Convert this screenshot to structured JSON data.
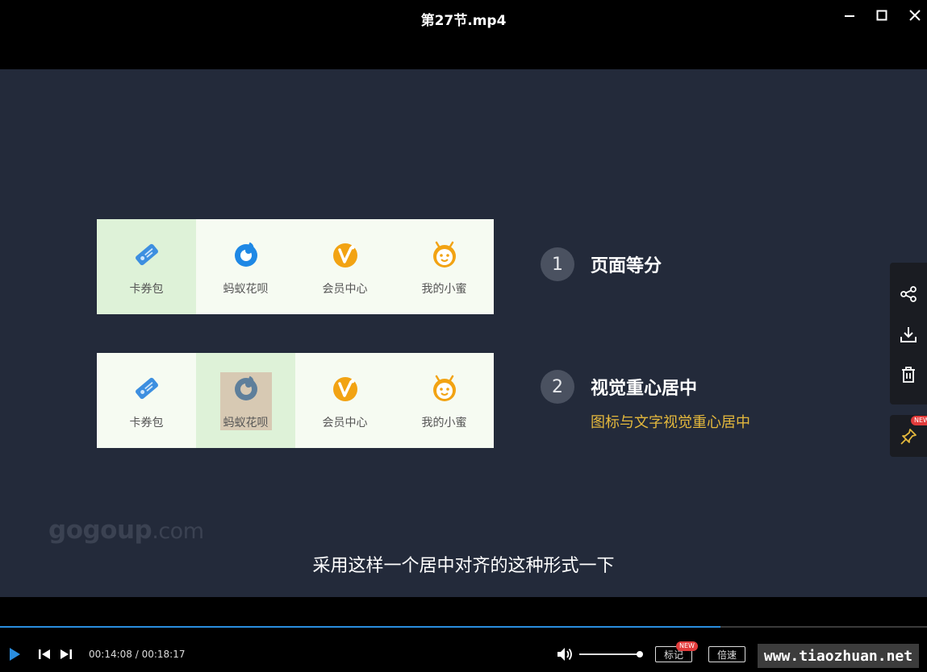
{
  "window": {
    "title": "第27节.mp4",
    "controls": [
      "minimize",
      "maximize",
      "close"
    ]
  },
  "slide": {
    "cards": [
      {
        "highlight_index": 0,
        "icon_box_highlight": false,
        "items": [
          {
            "label": "卡券包",
            "icon": "ticket-icon"
          },
          {
            "label": "蚂蚁花呗",
            "icon": "huabei-icon"
          },
          {
            "label": "会员中心",
            "icon": "member-v-icon"
          },
          {
            "label": "我的小蜜",
            "icon": "bee-icon"
          }
        ]
      },
      {
        "highlight_index": 1,
        "icon_box_highlight": true,
        "items": [
          {
            "label": "卡券包",
            "icon": "ticket-icon"
          },
          {
            "label": "蚂蚁花呗",
            "icon": "huabei-icon"
          },
          {
            "label": "会员中心",
            "icon": "member-v-icon"
          },
          {
            "label": "我的小蜜",
            "icon": "bee-icon"
          }
        ]
      }
    ],
    "points": [
      {
        "number": "1",
        "title": "页面等分"
      },
      {
        "number": "2",
        "title": "视觉重心居中",
        "subtitle": "图标与文字视觉重心居中"
      }
    ],
    "watermark_main": "gogoup",
    "watermark_suffix": ".com",
    "subtitle": "采用这样一个居中对齐的这种形式一下"
  },
  "side_toolbar": {
    "buttons": [
      "share-icon",
      "download-icon",
      "trash-icon"
    ],
    "pin_badge": "NEW"
  },
  "player": {
    "progress_fraction": 0.777,
    "time_current": "00:14:08",
    "time_total": "00:18:17",
    "time_separator": " / ",
    "volume_fraction": 1.0,
    "mark_label": "标记",
    "mark_badge": "NEW",
    "speed_label": "倍速",
    "site_tag": "www.tiaozhuan.net",
    "colors": {
      "accent": "#2a8ee0",
      "highlight": "#e4b83c",
      "video_bg": "#232a3a"
    }
  }
}
